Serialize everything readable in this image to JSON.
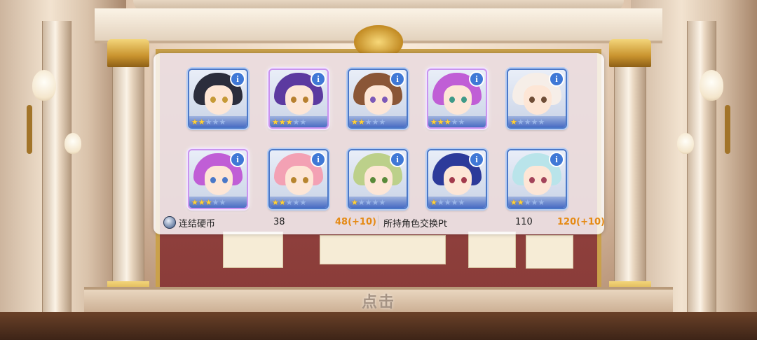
{
  "colors": {
    "star_on": "#ffd23a",
    "star_off": "#9bb6e8",
    "gain": "#e58a14",
    "info_button": "#3f78d6",
    "card_border": "#4b78c8"
  },
  "results": [
    {
      "stars": 2,
      "rarity": 1,
      "hair": "#2b2d3c",
      "eyes": "#c79a36",
      "info": "i"
    },
    {
      "stars": 3,
      "rarity": 3,
      "hair": "#5c3aa0",
      "eyes": "#b8802f",
      "info": "i"
    },
    {
      "stars": 2,
      "rarity": 1,
      "hair": "#8a5637",
      "eyes": "#7d59b8",
      "info": "i"
    },
    {
      "stars": 3,
      "rarity": 3,
      "hair": "#c05ed6",
      "eyes": "#3f9a88",
      "info": "i"
    },
    {
      "stars": 1,
      "rarity": 1,
      "hair": "#f6eee8",
      "eyes": "#6f4d36",
      "info": "i"
    },
    {
      "stars": 3,
      "rarity": 3,
      "hair": "#c05ed6",
      "eyes": "#4a78c8",
      "info": "i"
    },
    {
      "stars": 2,
      "rarity": 1,
      "hair": "#f3a1b4",
      "eyes": "#b8852e",
      "info": "i"
    },
    {
      "stars": 1,
      "rarity": 1,
      "hair": "#bcd08a",
      "eyes": "#5a8a3a",
      "info": "i"
    },
    {
      "stars": 1,
      "rarity": 1,
      "hair": "#2c3a9a",
      "eyes": "#a23a4c",
      "info": "i"
    },
    {
      "stars": 2,
      "rarity": 1,
      "hair": "#b9e4ea",
      "eyes": "#a3445a",
      "info": "i"
    }
  ],
  "currency_left": {
    "icon": "coin-icon",
    "label": "连结硬币",
    "value": "38",
    "gain": "48(+10)"
  },
  "currency_right": {
    "label": "所持角色交换Pt",
    "value": "110",
    "gain": "120(+10)"
  },
  "tap_hint": "点击"
}
